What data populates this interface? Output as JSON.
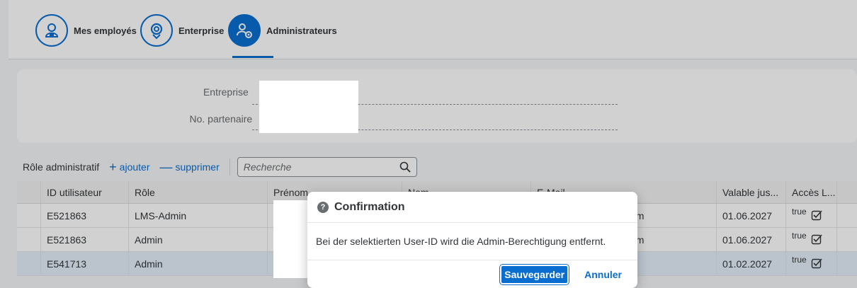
{
  "tabs": [
    {
      "label": "Mes employés",
      "icon": "employee-icon"
    },
    {
      "label": "Enterprise",
      "icon": "location-icon"
    },
    {
      "label": "Administrateurs",
      "icon": "admin-settings-icon"
    }
  ],
  "filter": {
    "enterprise_label": "Entreprise :",
    "required_mark": "*",
    "partner_label": "No. partenaire :"
  },
  "toolbar": {
    "title": "Rôle administratif",
    "add_label": "ajouter",
    "delete_label": "supprimer",
    "search_placeholder": "Recherche"
  },
  "table": {
    "columns": [
      "ID utilisateur",
      "Rôle",
      "Prénom",
      "Nom",
      "E-Mail",
      "Valable jus...",
      "Accès L..."
    ],
    "rows": [
      {
        "id": "E521863",
        "role": "LMS-Admin",
        "email_tail": "om",
        "valid": "01.06.2027",
        "access": "true"
      },
      {
        "id": "E521863",
        "role": "Admin",
        "email_tail": "om",
        "valid": "01.06.2027",
        "access": "true"
      },
      {
        "id": "E541713",
        "role": "Admin",
        "email_tail": "",
        "valid": "01.02.2027",
        "access": "true"
      }
    ]
  },
  "dialog": {
    "title": "Confirmation",
    "message": "Bei der selektierten User-ID wird die Admin-Berechtigung entfernt.",
    "confirm_label": "Sauvegarder",
    "cancel_label": "Annuler"
  },
  "colors": {
    "accent": "#0a6ed1"
  }
}
